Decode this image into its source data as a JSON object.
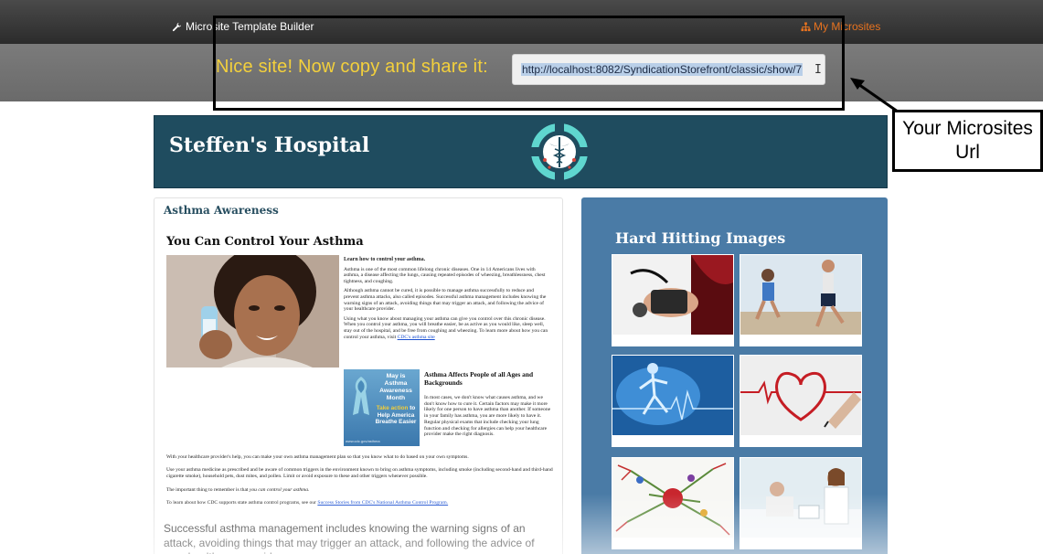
{
  "topbar": {
    "brand_label": "Microsite Template Builder",
    "brand_icon": "wrench-icon",
    "my_microsites_label": "My Microsites",
    "my_microsites_icon": "sitemap-icon",
    "accent_color": "#e8731f"
  },
  "share": {
    "title": "Nice site! Now copy and share it:",
    "url_value": "http://localhost:8082/SyndicationStorefront/classic/show/7",
    "title_color": "#f3d03c"
  },
  "annotation": {
    "label": "Your Microsites Url"
  },
  "hospital": {
    "name": "Steffen's Hospital",
    "logo_icon": "caduceus-logo-icon",
    "header_color": "#1f4c5f"
  },
  "left_panel": {
    "title": "Asthma Awareness",
    "article": {
      "title": "You Can Control Your Asthma",
      "section1_heading": "Learn how to control your asthma.",
      "p1": "Asthma is one of the most common lifelong chronic diseases. One in 14 Americans lives with asthma, a disease affecting the lungs, causing repeated episodes of wheezing, breathlessness, chest tightness, and coughing.",
      "p2": "Although asthma cannot be cured, it is possible to manage asthma successfully to reduce and prevent asthma attacks, also called episodes. Successful asthma management includes knowing the warning signs of an attack, avoiding things that may trigger an attack, and following the advice of your healthcare provider.",
      "p3": "Using what you know about managing your asthma can give you control over this chronic disease. When you control your asthma, you will breathe easier, be as active as you would like, sleep well, stay out of the hospital, and be free from coughing and wheezing. To learn more about how you can control your asthma, visit",
      "p3_link": "CDC's asthma site",
      "poster_line1": "May is Asthma Awareness Month",
      "poster_line2_highlight": "Take action",
      "poster_line2_rest": "to Help America Breathe Easier",
      "poster_credit": "www.cdc.gov/asthma",
      "section2_heading": "Asthma Affects People of all Ages and Backgrounds",
      "section2_body": "In most cases, we don't know what causes asthma, and we don't know how to cure it. Certain factors may make it more likely for one person to have asthma than another. If someone in your family has asthma, you are more likely to have it. Regular physical exams that include checking your lung function and checking for allergies can help your healthcare provider make the right diagnosis.",
      "f1": "With your healthcare provider's help, you can make your own asthma management plan so that you know what to do based on your own symptoms.",
      "f2": "Use your asthma medicine as prescribed and be aware of common triggers in the environment known to bring on asthma symptoms, including smoke (including second-hand and third-hand cigarette smoke), household pets, dust mites, and pollen. Limit or avoid exposure to these and other triggers whenever possible.",
      "f3_prefix": "The important thing to remember is that",
      "f3_italic": "you can control your asthma.",
      "f4_prefix": "To learn about how CDC supports state asthma control programs, see our",
      "f4_link": "Success Stories from CDC's National Asthma Control Program."
    },
    "summary": "Successful asthma management includes knowing the warning signs of an attack, avoiding things that may trigger an attack, and following the advice of your healthcare provider."
  },
  "right_panel": {
    "title": "Hard Hitting Images",
    "color": "#4a7ba6",
    "images": [
      {
        "name": "blood-pressure-image"
      },
      {
        "name": "runners-image"
      },
      {
        "name": "xray-runner-image"
      },
      {
        "name": "heart-ecg-drawing-image"
      },
      {
        "name": "mind-map-image"
      },
      {
        "name": "doctor-patient-image"
      }
    ]
  }
}
